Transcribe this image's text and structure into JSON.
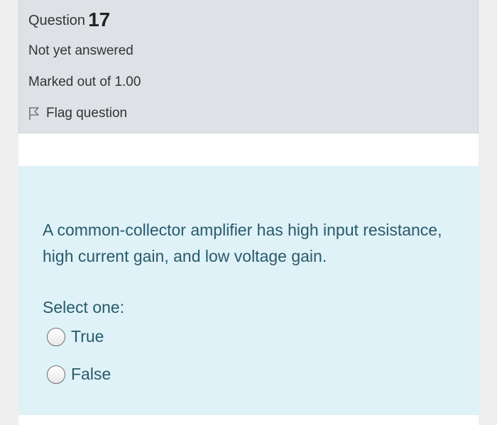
{
  "question": {
    "label": "Question",
    "number": "17",
    "state": "Not yet answered",
    "grade": "Marked out of 1.00",
    "flag_label": "Flag question"
  },
  "content": {
    "question_text": "A common-collector amplifier has high input resistance, high current gain, and low voltage gain.",
    "prompt": "Select one:",
    "options": [
      {
        "label": "True"
      },
      {
        "label": "False"
      }
    ]
  },
  "icons": {
    "flag": "flag-outline-icon",
    "radio": "radio-unchecked-icon"
  },
  "colors": {
    "info_bg": "#dee2e6",
    "content_bg": "#def2f8",
    "text_primary": "#2a5a6a"
  }
}
